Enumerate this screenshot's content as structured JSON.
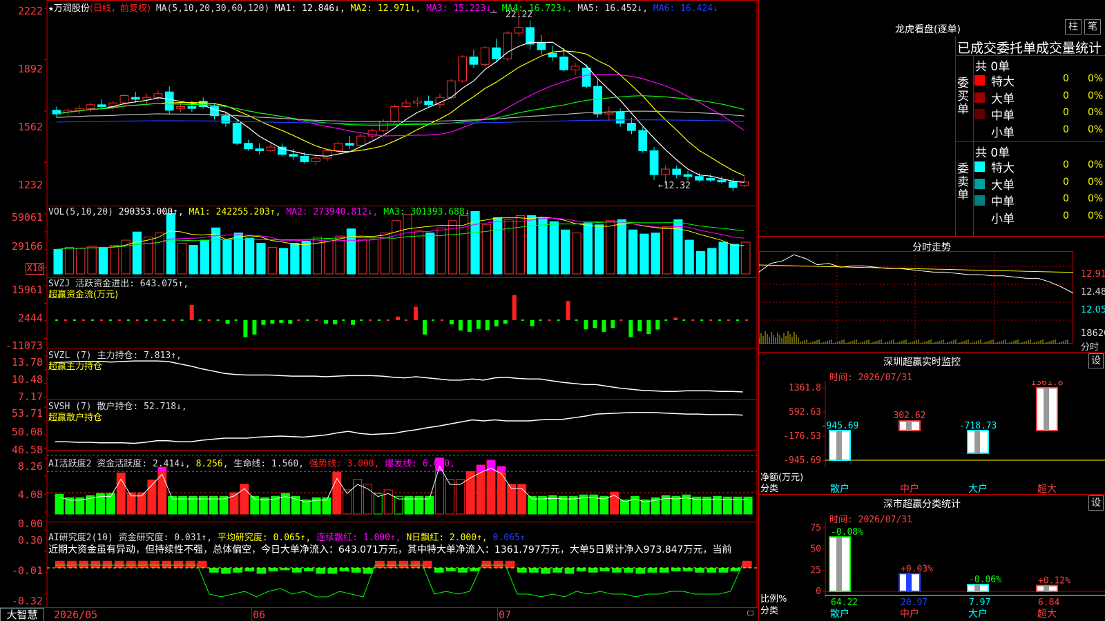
{
  "stock": {
    "star": "★",
    "name": "万润股份",
    "period": "(日线，前复权)"
  },
  "main_legend": {
    "ma_label": "MA(5,10,20,30,60,120)",
    "items": [
      {
        "label": "MA1: 12.846↓,",
        "color": "#ffffff"
      },
      {
        "label": "MA2: 12.971↓,",
        "color": "#ffff00"
      },
      {
        "label": "MA3: 15.223↓,",
        "color": "#ff00ff"
      },
      {
        "label": "MA4: 16.723↓,",
        "color": "#00ff00"
      },
      {
        "label": "MA5: 16.452↓,",
        "color": "#dddddd"
      },
      {
        "label": "MA6: 16.424↓",
        "color": "#2040ff"
      }
    ],
    "high_mark": "22.22",
    "low_mark": "←12.32"
  },
  "vol_legend": {
    "label": "VOL(5,10,20)",
    "value": "290353.000↑,",
    "ma1": "MA1: 242255.203↑,",
    "ma2": "MA2: 273940.812↓,",
    "ma3": "MA3: 301393.688↓",
    "unit_badge": "X10"
  },
  "svzj_legend": {
    "line1": "SVZJ  活跃资金进出: 643.075↑,",
    "line2": "超赢资金流(万元)"
  },
  "svzl_legend": {
    "line1": "SVZL (7) 主力持仓: 7.813↑,",
    "line2": "超赢主力持仓"
  },
  "svsh_legend": {
    "line1": "SVSH (7) 散户持仓: 52.718↓,",
    "line2": "超赢散户持仓"
  },
  "ai2_legend": {
    "a": "AI活跃度2 资金活跃度: 2.414↓,",
    "b": "8.256,",
    "c": "生命线: 1.560,",
    "d": "强势线: 3.000,",
    "e": "爆发线: 6.000,"
  },
  "ai3_legend": {
    "a": "AI研究度2(10) 资金研究度: 0.031↑,",
    "b": "平均研究度: 0.065↑,",
    "c": "连续飘红: 1.000↑,",
    "d": "N日飘红: 2.000↑,",
    "e": "0.065↑",
    "comment": "近期大资金虽有异动，但持续性不强，总体偏空，今日大单净流入：643.071万元，其中特大单净流入：1361.797万元，大单5日累计净入973.847万元，当前"
  },
  "axis_labels": {
    "main": [
      "2222",
      "1892",
      "1562",
      "1232"
    ],
    "vol": [
      "59061",
      "29166"
    ],
    "svzj": [
      "15961",
      "2444",
      "-11073"
    ],
    "svzl": [
      "13.78",
      "10.48",
      "7.17"
    ],
    "svsh": [
      "53.71",
      "50.08",
      "46.58"
    ],
    "ai2": [
      "8.26",
      "4.08",
      "0.00"
    ],
    "ai3": [
      "0.30",
      "-0.01",
      "-0.32"
    ]
  },
  "date_axis": {
    "d1": "2026/05",
    "d2": "06",
    "d3": "07"
  },
  "brand": "大智慧",
  "longhu": {
    "title": "龙虎看盘(逐单)",
    "btn1": "柱",
    "btn2": "笔",
    "subtitle": "已成交委托单成交量统计",
    "buy_label": "委买单",
    "sell_label": "委卖单",
    "buy_total": "共 0单",
    "sell_total": "共 0单",
    "buy_rows": [
      {
        "name": "特大",
        "count": "0",
        "pct": "0%",
        "color": "#ff0000"
      },
      {
        "name": "大单",
        "count": "0",
        "pct": "0%",
        "color": "#a00000"
      },
      {
        "name": "中单",
        "count": "0",
        "pct": "0%",
        "color": "#600000"
      },
      {
        "name": "小单",
        "count": "0",
        "pct": "0%",
        "color": ""
      }
    ],
    "sell_rows": [
      {
        "name": "特大",
        "count": "0",
        "pct": "0%",
        "color": "#00ffff"
      },
      {
        "name": "大单",
        "count": "0",
        "pct": "0%",
        "color": "#00a0a0"
      },
      {
        "name": "中单",
        "count": "0",
        "pct": "0%",
        "color": "#008080"
      },
      {
        "name": "小单",
        "count": "0",
        "pct": "0%",
        "color": ""
      }
    ]
  },
  "intraday": {
    "title": "分时走势",
    "p1": "12.91",
    "p2": "12.48",
    "p3": "12.05",
    "vol": "18620",
    "vol_unit": "分时"
  },
  "sz_monitor": {
    "title": "深圳超赢实时监控",
    "btn": "设",
    "time": "时间: 2026/07/31",
    "yticks": [
      "1361.8",
      "592.63",
      "-176.53",
      "-945.69"
    ],
    "ylabel1": "净额(万元)",
    "ylabel2": "分类"
  },
  "sz_stats": {
    "title": "深市超赢分类统计",
    "btn": "设",
    "time": "时间: 2026/07/31",
    "yticks": [
      "75",
      "50",
      "25",
      "0"
    ],
    "ylabel1": "比例%",
    "ylabel2": "分类"
  },
  "chart_data": [
    {
      "type": "candlestick",
      "title": "万润股份 (日线，前复权)",
      "x_range": [
        "2026/05",
        "2026/07/31"
      ],
      "ylim": [
        12.0,
        22.4
      ],
      "ohlc": [
        [
          16.7,
          16.9,
          16.3,
          16.5
        ],
        [
          16.6,
          16.8,
          16.4,
          16.7
        ],
        [
          16.7,
          17.0,
          16.5,
          16.8
        ],
        [
          16.8,
          17.1,
          16.6,
          17.0
        ],
        [
          17.0,
          17.3,
          16.8,
          16.9
        ],
        [
          16.9,
          17.2,
          16.7,
          17.1
        ],
        [
          17.1,
          17.6,
          16.9,
          17.5
        ],
        [
          17.4,
          17.7,
          17.1,
          17.3
        ],
        [
          17.3,
          17.6,
          17.0,
          17.4
        ],
        [
          17.4,
          17.8,
          17.2,
          17.6
        ],
        [
          17.7,
          18.0,
          16.5,
          16.7
        ],
        [
          16.8,
          17.1,
          16.6,
          16.9
        ],
        [
          16.9,
          17.2,
          16.6,
          16.8
        ],
        [
          17.2,
          17.4,
          16.8,
          16.9
        ],
        [
          16.9,
          17.1,
          16.2,
          16.4
        ],
        [
          16.4,
          16.6,
          15.8,
          16.0
        ],
        [
          16.0,
          16.2,
          14.8,
          14.9
        ],
        [
          14.9,
          15.1,
          14.5,
          14.6
        ],
        [
          14.6,
          14.9,
          14.3,
          14.5
        ],
        [
          14.5,
          14.9,
          14.4,
          14.7
        ],
        [
          14.7,
          14.9,
          14.2,
          14.3
        ],
        [
          14.3,
          14.6,
          14.0,
          14.2
        ],
        [
          14.2,
          14.4,
          13.8,
          13.9
        ],
        [
          13.9,
          14.3,
          13.7,
          14.1
        ],
        [
          14.1,
          14.6,
          13.9,
          14.5
        ],
        [
          14.5,
          15.0,
          14.4,
          14.9
        ],
        [
          14.9,
          15.3,
          14.6,
          14.8
        ],
        [
          14.8,
          15.4,
          14.7,
          15.3
        ],
        [
          15.3,
          15.7,
          15.1,
          15.6
        ],
        [
          15.6,
          16.2,
          15.5,
          16.1
        ],
        [
          16.1,
          17.0,
          16.0,
          16.9
        ],
        [
          16.9,
          17.3,
          16.8,
          17.1
        ],
        [
          17.1,
          17.4,
          16.9,
          17.2
        ],
        [
          17.2,
          17.5,
          16.9,
          17.0
        ],
        [
          17.0,
          17.6,
          16.8,
          17.4
        ],
        [
          17.4,
          18.4,
          17.3,
          18.3
        ],
        [
          18.3,
          19.7,
          18.2,
          19.6
        ],
        [
          19.6,
          20.0,
          19.0,
          19.2
        ],
        [
          19.2,
          20.2,
          19.1,
          20.1
        ],
        [
          20.1,
          20.6,
          19.3,
          19.5
        ],
        [
          19.5,
          21.0,
          19.4,
          20.9
        ],
        [
          20.9,
          22.2,
          20.7,
          21.2
        ],
        [
          21.2,
          21.6,
          20.0,
          20.3
        ],
        [
          20.4,
          20.8,
          19.7,
          20.0
        ],
        [
          19.8,
          20.2,
          19.4,
          19.6
        ],
        [
          19.6,
          20.1,
          18.8,
          18.9
        ],
        [
          18.9,
          19.3,
          18.6,
          19.1
        ],
        [
          19.0,
          19.2,
          17.9,
          18.0
        ],
        [
          18.0,
          18.4,
          16.3,
          16.5
        ],
        [
          16.5,
          16.9,
          16.1,
          16.6
        ],
        [
          16.6,
          16.8,
          15.8,
          16.0
        ],
        [
          16.0,
          16.3,
          15.4,
          15.6
        ],
        [
          15.6,
          15.8,
          14.4,
          14.5
        ],
        [
          14.5,
          14.7,
          12.9,
          13.2
        ],
        [
          13.2,
          13.7,
          12.6,
          13.5
        ],
        [
          13.5,
          13.7,
          13.0,
          13.2
        ],
        [
          13.2,
          13.4,
          12.9,
          13.1
        ],
        [
          13.1,
          13.3,
          12.8,
          12.9
        ],
        [
          13.0,
          13.2,
          12.8,
          12.9
        ],
        [
          12.9,
          13.1,
          12.7,
          12.8
        ],
        [
          12.8,
          13.0,
          12.3,
          12.5
        ],
        [
          12.6,
          13.1,
          12.5,
          12.8
        ]
      ],
      "ma_periods": [
        5,
        10,
        20,
        30,
        60,
        120
      ]
    },
    {
      "type": "bar",
      "title": "VOL(5,10,20)",
      "unit": "X10",
      "ylim": [
        0,
        62000
      ],
      "values": [
        24000,
        26000,
        25000,
        27000,
        26000,
        28000,
        33000,
        41000,
        36000,
        40000,
        59000,
        30000,
        28000,
        33000,
        45000,
        33000,
        40000,
        35000,
        30000,
        26000,
        25000,
        30000,
        32000,
        36000,
        34000,
        37000,
        44000,
        34000,
        34000,
        40000,
        52000,
        58000,
        42000,
        40000,
        45000,
        52000,
        57000,
        61000,
        48000,
        55000,
        53000,
        57000,
        57000,
        55000,
        51000,
        43000,
        40000,
        50000,
        48000,
        52000,
        53000,
        43000,
        39000,
        40000,
        46000,
        53000,
        33000,
        22000,
        25000,
        31000,
        29000,
        31000
      ]
    },
    {
      "type": "bar",
      "title": "SVZJ 活跃资金进出 (万元)",
      "ylim": [
        -11073,
        15961
      ],
      "values": [
        0,
        0,
        0,
        0,
        0,
        0,
        0,
        0,
        0,
        0,
        0,
        0,
        0,
        0,
        0,
        6800,
        0,
        0,
        0,
        -1600,
        0,
        -7600,
        -6400,
        -2100,
        -1600,
        -1300,
        -1600,
        0,
        0,
        0,
        -1600,
        -1900,
        0,
        -2100,
        0,
        0,
        0,
        0,
        1600,
        0,
        6000,
        -6400,
        0,
        0,
        -1900,
        -4600,
        -5200,
        -3900,
        -4400,
        -2800,
        -1600,
        11200,
        0,
        -2700,
        0,
        0,
        0,
        8500,
        0,
        -4100,
        -3500,
        -5200,
        -3500,
        0,
        -7600,
        -5000,
        -6200,
        -4200,
        0,
        1100,
        0,
        0,
        0,
        0,
        0,
        0,
        0,
        0
      ]
    },
    {
      "type": "line",
      "title": "SVZL (7) 主力持仓",
      "ylim": [
        7.17,
        13.78
      ],
      "values": [
        13.1,
        13.2,
        13.3,
        13.3,
        13.3,
        13.2,
        13.3,
        13.4,
        13.4,
        13.4,
        13.3,
        12.9,
        12.5,
        12.0,
        11.6,
        11.2,
        11.0,
        10.9,
        10.9,
        10.9,
        10.8,
        10.7,
        10.7,
        10.7,
        10.6,
        10.7,
        10.8,
        10.8,
        10.8,
        10.7,
        10.5,
        10.4,
        10.6,
        10.4,
        10.2,
        10.0,
        10.0,
        10.2,
        10.0,
        10.4,
        10.5,
        10.3,
        10.2,
        10.2,
        9.9,
        9.6,
        9.4,
        9.2,
        9.2,
        8.9,
        8.6,
        8.4,
        8.2,
        8.1,
        8.0,
        8.0,
        8.1,
        8.1,
        8.1,
        8.0,
        8.0,
        7.9
      ]
    },
    {
      "type": "line",
      "title": "SVSH (7) 散户持仓",
      "ylim": [
        46.58,
        53.71
      ],
      "values": [
        47.6,
        47.6,
        47.5,
        47.5,
        47.4,
        47.4,
        47.4,
        47.3,
        47.5,
        47.8,
        47.8,
        47.6,
        47.6,
        47.9,
        48.1,
        48.3,
        48.3,
        48.3,
        48.5,
        48.6,
        48.7,
        48.6,
        48.5,
        48.7,
        48.9,
        49.3,
        49.6,
        49.2,
        49.0,
        49.1,
        49.2,
        49.6,
        49.9,
        50.3,
        50.6,
        51.0,
        51.4,
        51.8,
        51.6,
        51.8,
        51.6,
        51.6,
        51.6,
        51.8,
        51.9,
        51.9,
        52.2,
        52.5,
        52.9,
        53.0,
        53.1,
        53.2,
        53.2,
        53.2,
        53.1,
        53.0,
        52.9,
        52.9,
        52.8,
        52.8,
        52.8,
        52.7
      ]
    },
    {
      "type": "bar",
      "title": "AI活跃度2 资金活跃度",
      "ylim": [
        0,
        8.26
      ],
      "lines": {
        "生命线": 1.56,
        "强势线": 3.0,
        "爆发线": 6.0
      },
      "values": [
        2.8,
        2.3,
        2.3,
        2.6,
        2.9,
        2.9,
        5.8,
        3.0,
        3.0,
        4.8,
        6.6,
        2.5,
        2.5,
        2.5,
        2.5,
        2.5,
        2.5,
        3.0,
        4.2,
        2.5,
        2.3,
        2.5,
        2.9,
        2.5,
        2.0,
        2.3,
        2.3,
        5.9,
        3.4,
        4.9,
        4.2,
        2.9,
        3.4,
        2.5,
        2.5,
        2.5,
        2.5,
        7.9,
        4.9,
        4.9,
        6.0,
        6.9,
        7.6,
        6.7,
        4.2,
        4.2,
        2.5,
        2.5,
        2.6,
        2.5,
        2.5,
        2.7,
        2.7,
        2.5,
        3.1,
        2.0,
        2.5,
        2.0,
        2.3,
        2.6,
        2.5,
        2.7,
        2.4,
        2.4,
        2.5,
        2.4,
        2.4,
        2.4
      ]
    },
    {
      "type": "bar",
      "title": "AI研究度2(10) 资金研究度",
      "ylim": [
        -0.32,
        0.3
      ],
      "values": [
        0.031,
        0.031,
        0.031,
        0.031,
        0.031,
        0.031,
        0.031,
        0.031,
        0.031,
        0.031,
        0.031,
        0.031,
        0.031,
        -0.05,
        -0.06,
        -0.05,
        -0.04,
        -0.06,
        -0.04,
        -0.03,
        -0.05,
        -0.04,
        -0.06,
        -0.06,
        -0.04,
        -0.05,
        -0.06,
        0.031,
        0.031,
        0.031,
        0.031,
        0.031,
        -0.05,
        -0.04,
        -0.05,
        -0.04,
        0.031,
        0.031,
        0.031,
        -0.05,
        -0.05,
        -0.06,
        -0.05,
        -0.06,
        -0.04,
        -0.05,
        -0.04,
        -0.05,
        -0.05,
        -0.06,
        -0.05,
        -0.05,
        -0.04,
        -0.04,
        -0.05,
        -0.05,
        -0.05,
        -0.04,
        0.031
      ]
    },
    {
      "type": "line",
      "title": "分时走势",
      "ylim": [
        12.05,
        12.91
      ],
      "values": [
        12.88,
        12.95,
        12.97,
        13.02,
        12.99,
        12.94,
        12.95,
        12.92,
        12.93,
        12.93,
        12.92,
        12.91,
        12.91,
        12.9,
        12.89,
        12.88,
        12.88,
        12.87,
        12.86,
        12.86,
        12.85,
        12.85,
        12.84,
        12.83,
        12.83,
        12.8,
        12.76,
        12.71
      ]
    },
    {
      "type": "bar",
      "title": "深圳超赢实时监控",
      "ylabel": "净额(万元)",
      "categories": [
        "散户",
        "中户",
        "大户",
        "超大"
      ],
      "values": [
        -945.69,
        302.62,
        -718.73,
        1361.8
      ],
      "ylim": [
        -945.69,
        1361.8
      ]
    },
    {
      "type": "bar",
      "title": "深市超赢分类统计",
      "ylabel": "比例%",
      "categories": [
        "散户",
        "中户",
        "大户",
        "超大"
      ],
      "values": [
        64.22,
        20.97,
        7.97,
        6.84
      ],
      "changes": [
        "-0.08%",
        "+0.03%",
        "-0.06%",
        "+0.12%"
      ],
      "ylim": [
        0,
        75
      ]
    }
  ]
}
